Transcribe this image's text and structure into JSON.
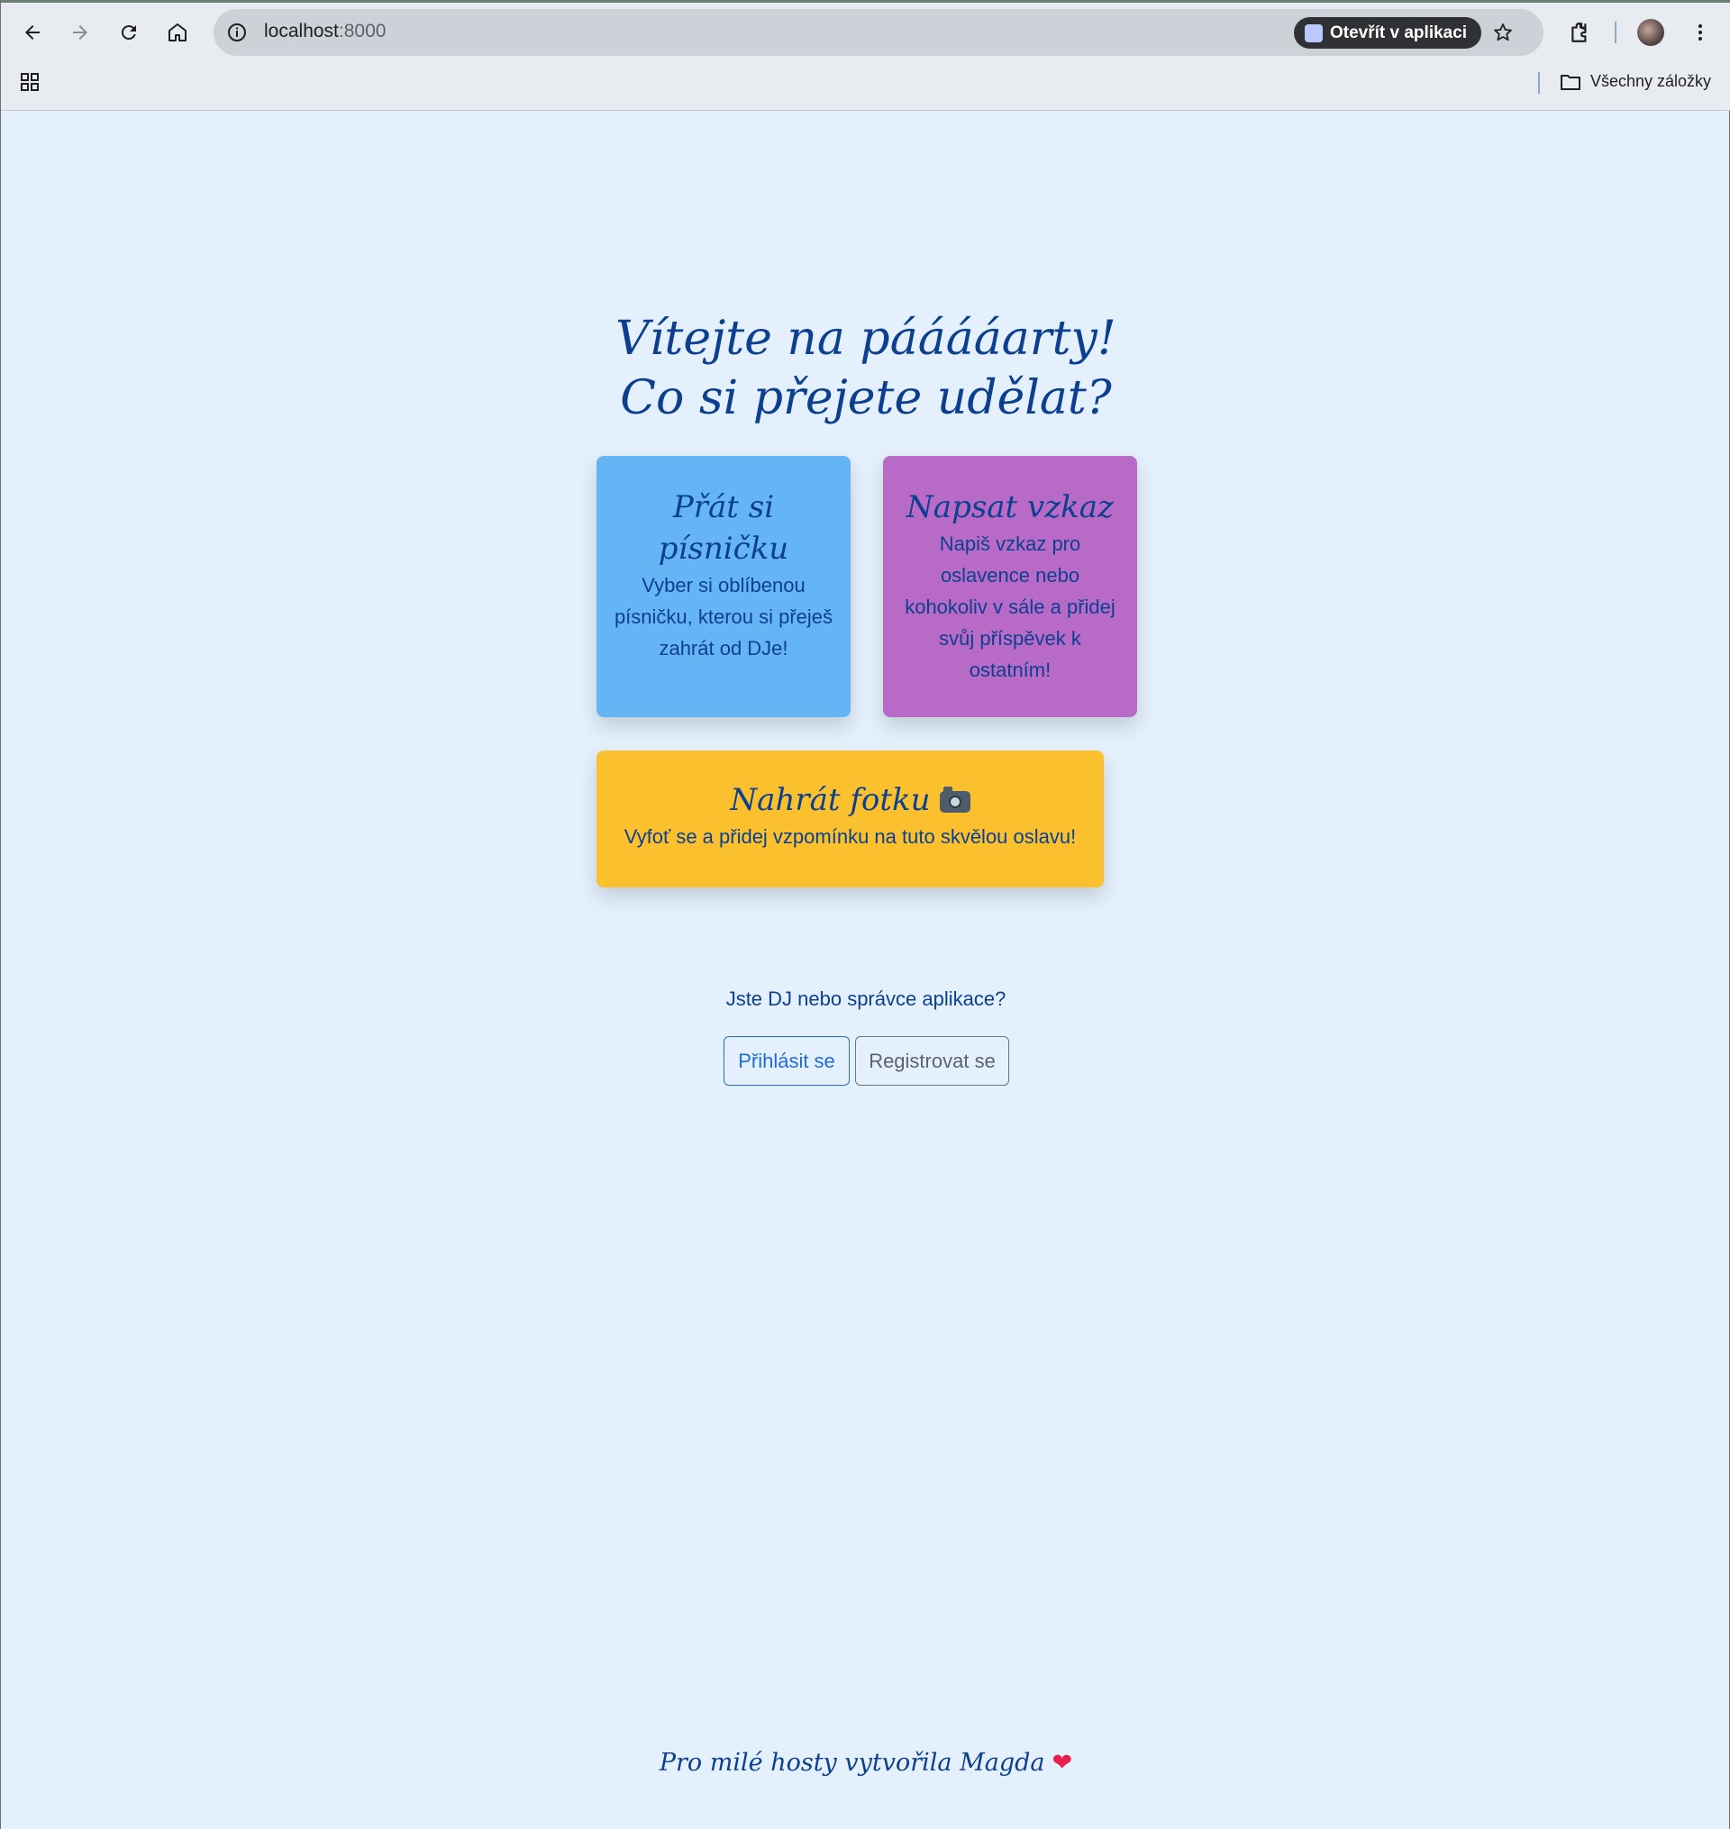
{
  "browser": {
    "url_host": "localhost",
    "url_port": ":8000",
    "open_in_app_label": "Otevřít v aplikaci",
    "bookmarks_label": "Všechny záložky"
  },
  "main": {
    "title_line1": "Vítejte na pááááarty!",
    "title_line2": "Co si přejete udělat?",
    "cards": [
      {
        "title": "Přát si písničku",
        "description": "Vyber si oblíbenou písničku, kterou si přeješ zahrát od DJe!",
        "color": "#65b5f6"
      },
      {
        "title": "Napsat vzkaz",
        "description": "Napiš vzkaz pro oslavence nebo kohokoliv v sále a přidej svůj příspěvek k ostatním!",
        "color": "#b86bc6"
      },
      {
        "title": "Nahrát fotku",
        "description": "Vyfoť se a přidej vzpomínku na tuto skvělou oslavu!",
        "color": "#fbc02d",
        "icon": "camera-icon"
      }
    ],
    "dj_prompt": "Jste DJ nebo správce aplikace?",
    "login_label": "Přihlásit se",
    "register_label": "Registrovat se"
  },
  "footer": {
    "text": "Pro milé hosty vytvořila Magda",
    "icon": "heart-icon"
  }
}
